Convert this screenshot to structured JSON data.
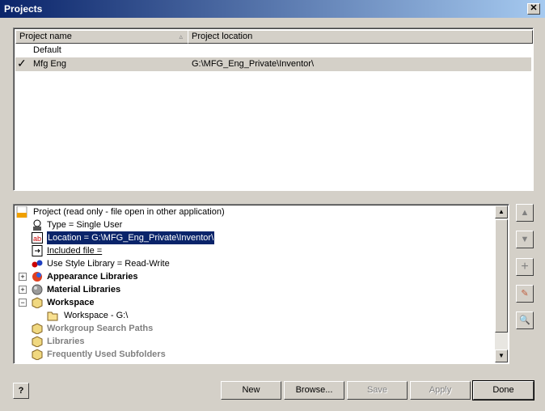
{
  "window": {
    "title": "Projects",
    "close_label": "✕"
  },
  "projects_list": {
    "columns": [
      "Project name",
      "Project location"
    ],
    "rows": [
      {
        "name": "Default",
        "location": "",
        "active": false
      },
      {
        "name": "Mfg Eng",
        "location": "G:\\MFG_Eng_Private\\Inventor\\",
        "active": true
      }
    ]
  },
  "tree": {
    "items": [
      {
        "label": "Project (read only - file open in other application)"
      },
      {
        "label": "Type = Single User"
      },
      {
        "label": "Location = G:\\MFG_Eng_Private\\Inventor\\"
      },
      {
        "label": "Included file ="
      },
      {
        "label": "Use Style Library = Read-Write"
      },
      {
        "label": "Appearance Libraries"
      },
      {
        "label": "Material Libraries"
      },
      {
        "label": "Workspace"
      },
      {
        "label": "Workspace - G:\\"
      },
      {
        "label": "Workgroup Search Paths"
      },
      {
        "label": "Libraries"
      },
      {
        "label": "Frequently Used Subfolders"
      }
    ]
  },
  "side_buttons": {
    "up": "▲",
    "down": "▼",
    "add": "+",
    "edit": "✎",
    "find": "🔍"
  },
  "buttons": {
    "help": "?",
    "new": "New",
    "browse": "Browse...",
    "save": "Save",
    "apply": "Apply",
    "done": "Done"
  }
}
